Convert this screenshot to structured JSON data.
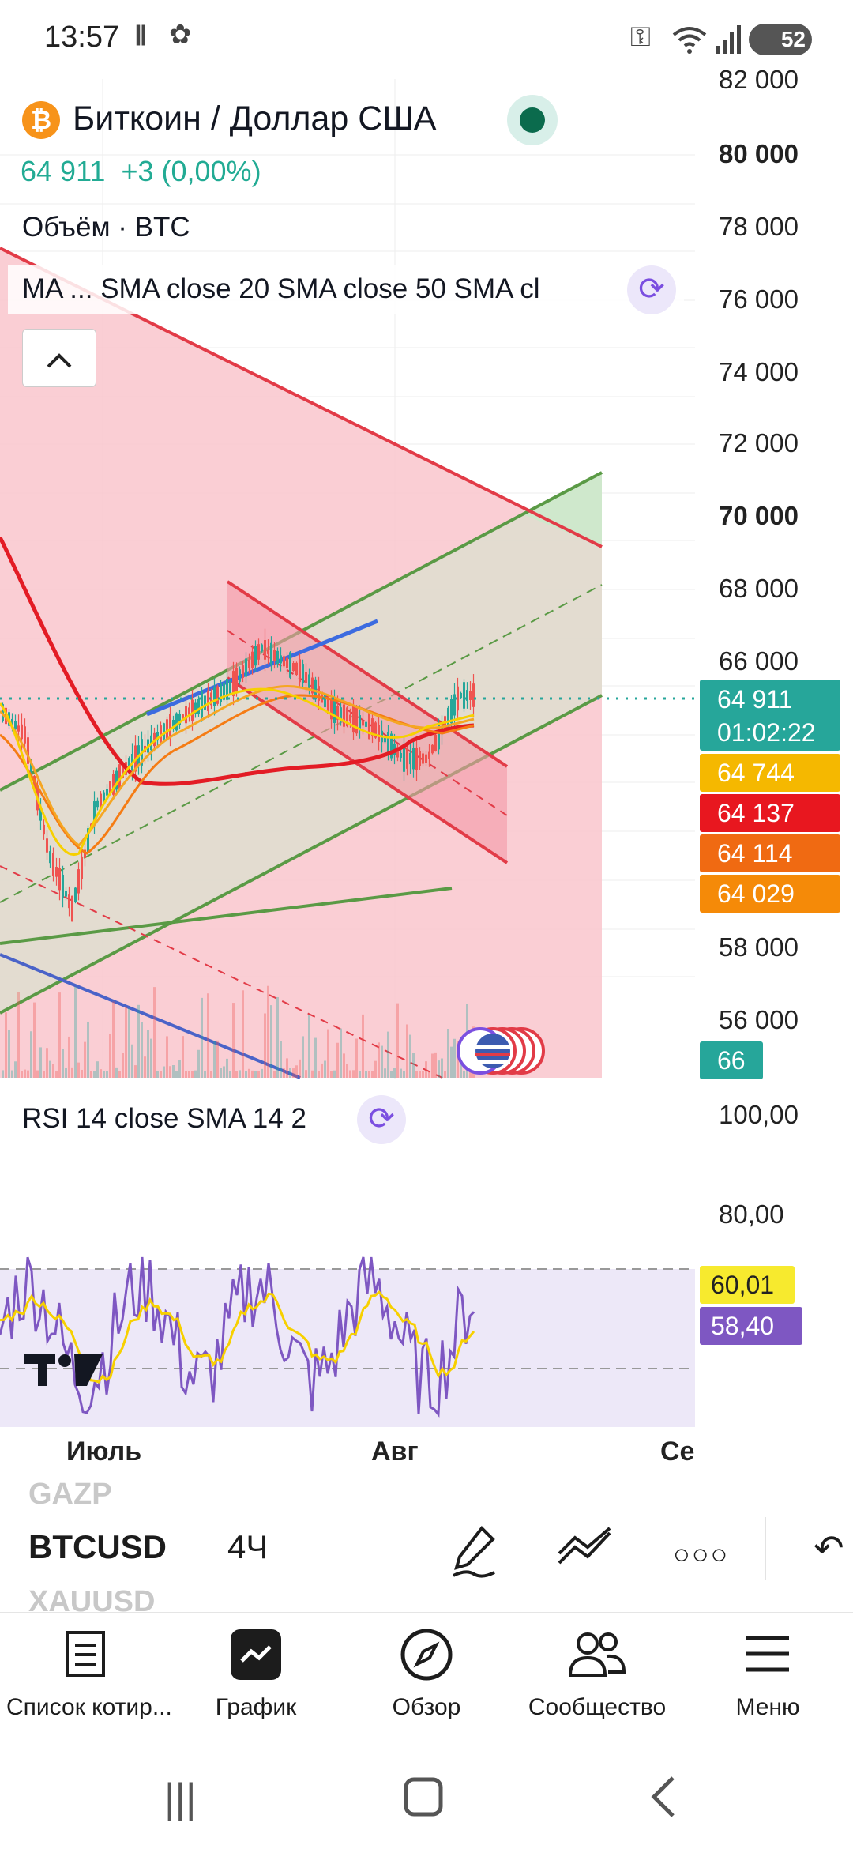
{
  "status_bar": {
    "time": "13:57",
    "icons": [
      "notification-icon",
      "app-icon",
      "vpn-key-icon",
      "wifi-icon",
      "signal-icon"
    ],
    "battery": "52"
  },
  "symbol": {
    "name": "Биткоин / Доллар США",
    "price": "64 911",
    "change": "+3 (0,00%)",
    "volume_label": "Объём · BTC",
    "ma_label": "MA ...   SMA close 20 SMA close 50 SMA cl",
    "logo_letter": "₿"
  },
  "colors": {
    "up": "#22ab94",
    "down": "#f23645",
    "accent": "#7b4fe0",
    "pink_fill": "#f9c6cc",
    "green_fill": "#cfe8cc"
  },
  "price_axis": {
    "labels": [
      "82 000",
      "80 000",
      "78 000",
      "76 000",
      "74 000",
      "72 000",
      "70 000",
      "68 000",
      "66 000",
      "58 000",
      "56 000"
    ],
    "bold": [
      "80 000",
      "70 000"
    ]
  },
  "price_tags": [
    {
      "value": "64 911",
      "sub": "01:02:22",
      "color": "#26a69a"
    },
    {
      "value": "64 744",
      "color": "#f5b800"
    },
    {
      "value": "64 137",
      "color": "#e8171f"
    },
    {
      "value": "64 114",
      "color": "#f06a12"
    },
    {
      "value": "64 029",
      "color": "#f58a08"
    }
  ],
  "volume_tag": {
    "value": "66",
    "color": "#26a69a"
  },
  "rsi": {
    "label": "RSI 14 close SMA 14 2",
    "axis_labels": [
      "100,00",
      "80,00"
    ],
    "tags": [
      {
        "value": "60,01",
        "color": "#f7ea2e",
        "text_color": "#222222"
      },
      {
        "value": "58,40",
        "color": "#7e57c2",
        "text_color": "#ffffff"
      }
    ]
  },
  "time_axis": [
    "Июль",
    "Авг",
    "Се"
  ],
  "toolbar": {
    "ghost_above": "GAZP",
    "symbol": "BTCUSD",
    "ghost_below": "XAUUSD",
    "interval": "4Ч",
    "icons": [
      "draw-pen-icon",
      "trendline-icon",
      "more-dots-icon",
      "undo-icon"
    ]
  },
  "bottom_nav": [
    {
      "label": "Список котир...",
      "icon": "watchlist-icon"
    },
    {
      "label": "График",
      "icon": "chart-icon"
    },
    {
      "label": "Обзор",
      "icon": "compass-icon"
    },
    {
      "label": "Сообщество",
      "icon": "community-icon"
    },
    {
      "label": "Меню",
      "icon": "menu-icon"
    }
  ]
}
